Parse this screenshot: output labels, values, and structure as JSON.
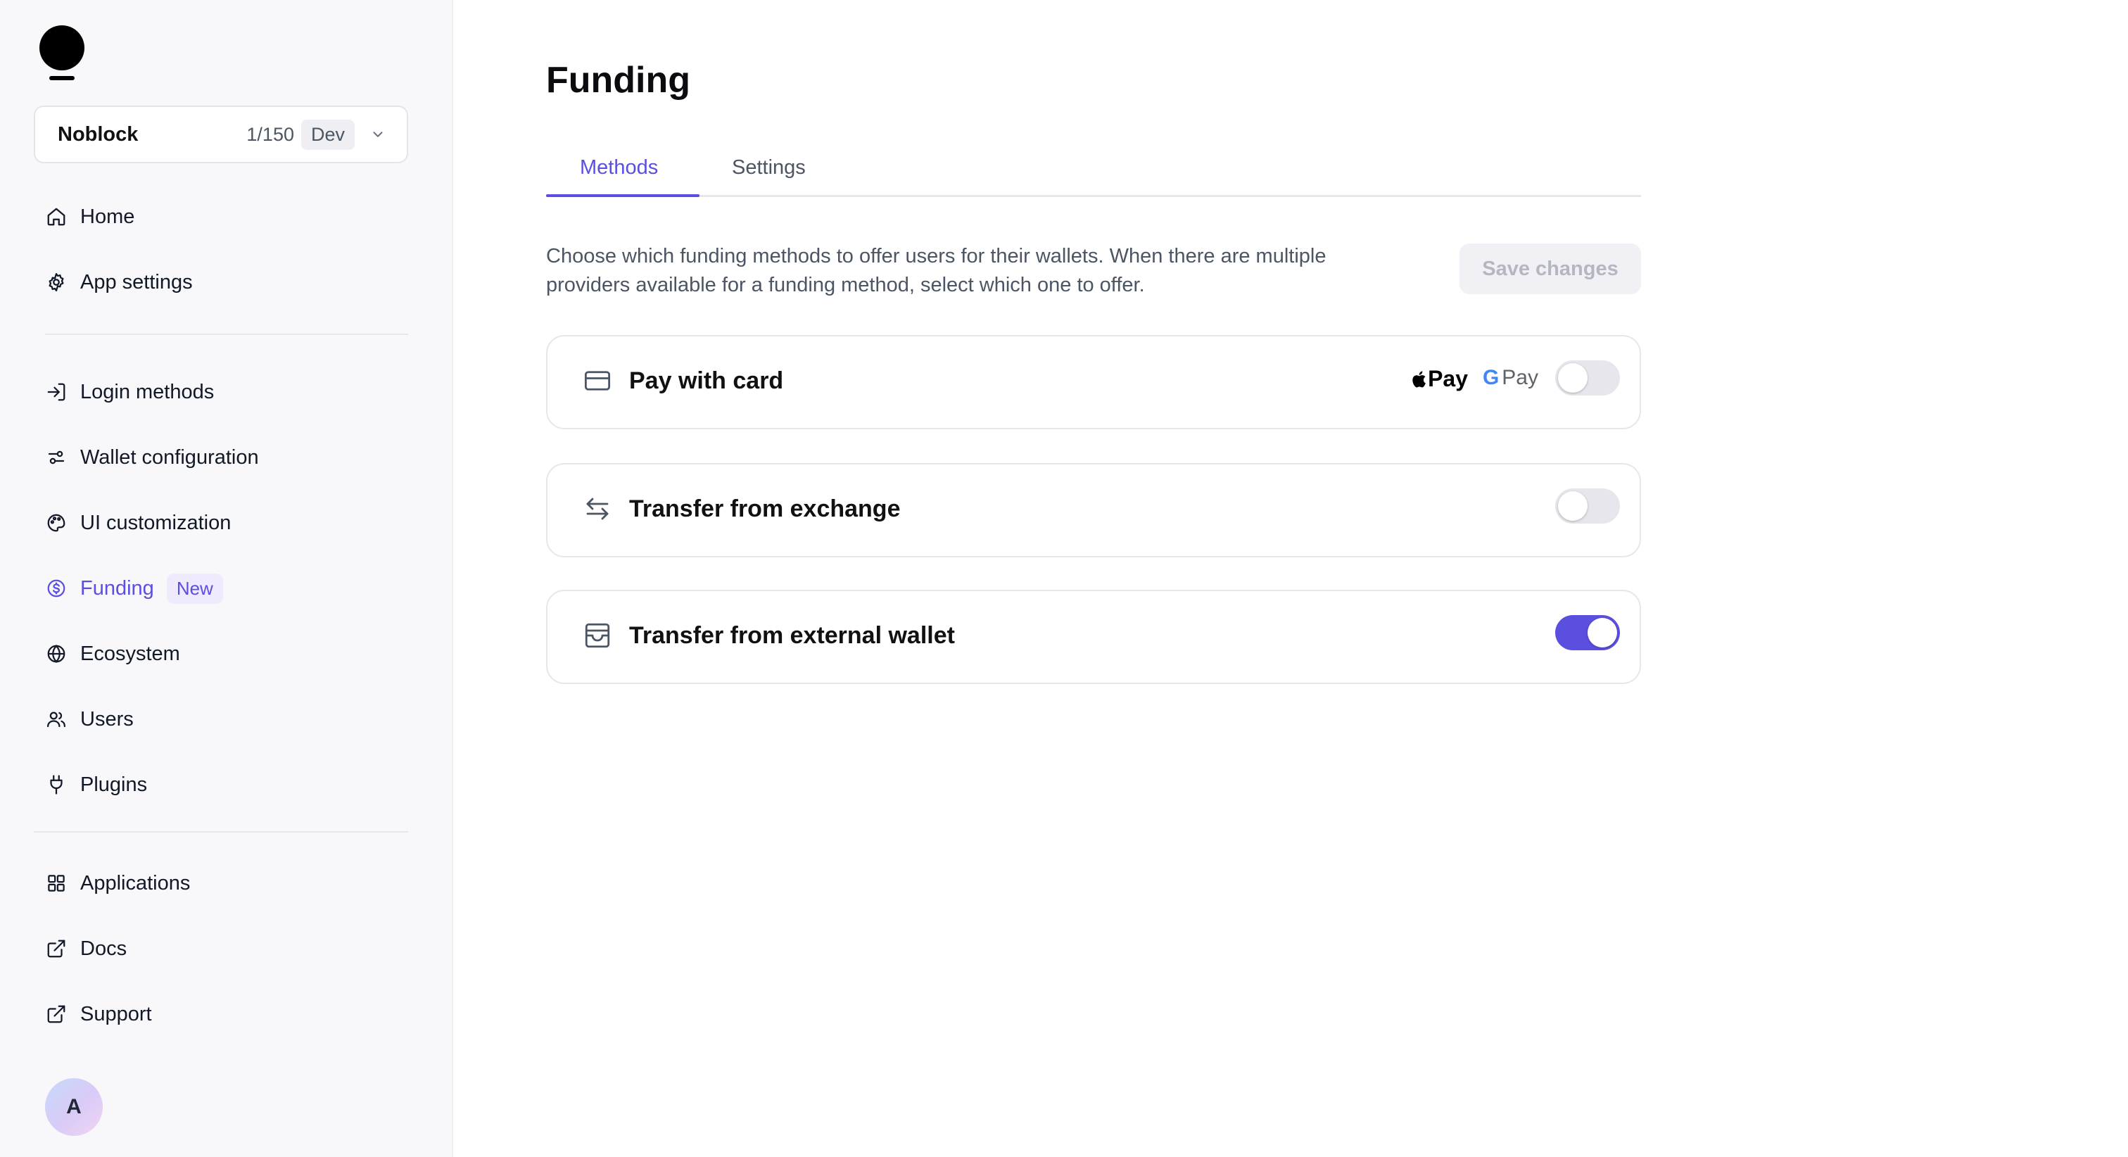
{
  "sidebar": {
    "app_selector": {
      "name": "Noblock",
      "count": "1/150",
      "env": "Dev"
    },
    "primary_nav": [
      {
        "label": "Home",
        "icon": "home-icon"
      },
      {
        "label": "App settings",
        "icon": "gear-icon"
      }
    ],
    "config_nav": [
      {
        "label": "Login methods",
        "icon": "login-icon"
      },
      {
        "label": "Wallet configuration",
        "icon": "sliders-icon"
      },
      {
        "label": "UI customization",
        "icon": "palette-icon"
      },
      {
        "label": "Funding",
        "icon": "dollar-circle-icon",
        "badge": "New",
        "active": true
      },
      {
        "label": "Ecosystem",
        "icon": "globe-icon"
      },
      {
        "label": "Users",
        "icon": "users-icon"
      },
      {
        "label": "Plugins",
        "icon": "plug-icon"
      }
    ],
    "footer_nav": [
      {
        "label": "Applications",
        "icon": "grid-icon"
      },
      {
        "label": "Docs",
        "icon": "external-link-icon"
      },
      {
        "label": "Support",
        "icon": "external-link-icon"
      }
    ],
    "avatar_initial": "A"
  },
  "main": {
    "title": "Funding",
    "tabs": [
      {
        "label": "Methods",
        "active": true
      },
      {
        "label": "Settings",
        "active": false
      }
    ],
    "description": "Choose which funding methods to offer users for their wallets. When there are multiple providers available for a funding method, select which one to offer.",
    "save_label": "Save changes",
    "methods": [
      {
        "label": "Pay with card",
        "icon": "credit-card-icon",
        "enabled": false,
        "providers": [
          "Pay",
          "Pay"
        ]
      },
      {
        "label": "Transfer from exchange",
        "icon": "arrows-exchange-icon",
        "enabled": false
      },
      {
        "label": "Transfer from external wallet",
        "icon": "wallet-icon",
        "enabled": true
      }
    ]
  },
  "colors": {
    "accent": "#5b4fe0",
    "sidebar_bg": "#f8f8fa",
    "toggle_off": "#e6e6ec"
  }
}
